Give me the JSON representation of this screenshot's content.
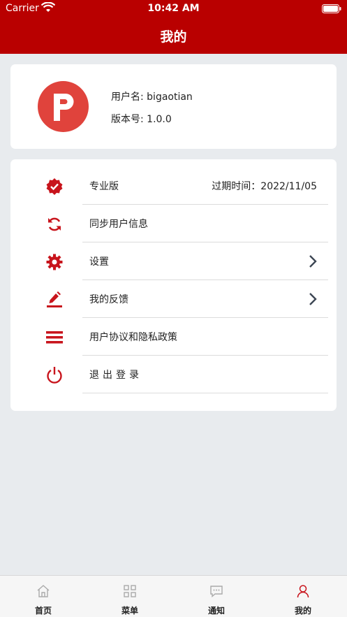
{
  "status_bar": {
    "carrier": "Carrier",
    "time": "10:42 AM"
  },
  "header": {
    "title": "我的",
    "background": "#b90000"
  },
  "profile": {
    "avatar_letter": "P",
    "username_line": "用户名: bigaotian",
    "version_line": "版本号: 1.0.0"
  },
  "menu": {
    "items": [
      {
        "icon": "verified-badge-icon",
        "label": "专业版",
        "right_text": "过期时间：2022/11/05"
      },
      {
        "icon": "sync-icon",
        "label": "同步用户信息"
      },
      {
        "icon": "gear-icon",
        "label": "设置",
        "chevron": true
      },
      {
        "icon": "edit-pencil-icon",
        "label": "我的反馈",
        "chevron": true
      },
      {
        "icon": "document-lines-icon",
        "label": "用户协议和隐私政策"
      },
      {
        "icon": "power-icon",
        "label": "退出登录"
      }
    ]
  },
  "tab_bar": {
    "tabs": [
      {
        "label": "首页",
        "icon": "home-icon",
        "active": false
      },
      {
        "label": "菜单",
        "icon": "grid-icon",
        "active": false
      },
      {
        "label": "通知",
        "icon": "message-icon",
        "active": false
      },
      {
        "label": "我的",
        "icon": "user-icon",
        "active": true
      }
    ]
  },
  "colors": {
    "accent": "#b90000",
    "icon_red": "#c8141c",
    "avatar": "#e0433c"
  }
}
